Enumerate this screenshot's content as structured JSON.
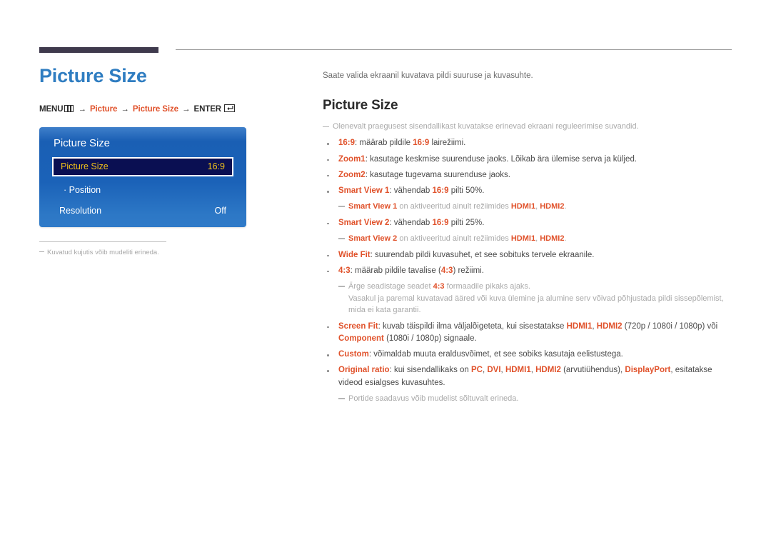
{
  "header": {
    "accent_bar_color": "#3f3a4d",
    "rule_color": "#9b9b9b"
  },
  "left": {
    "page_title": "Picture Size",
    "menu_path": {
      "menu_label": "MENU",
      "menu_icon": "menu-grid-icon",
      "arrow1": "→",
      "item1": "Picture",
      "arrow2": "→",
      "item2": "Picture Size",
      "arrow3": "→",
      "enter_label": "ENTER",
      "enter_icon": "enter-return-icon"
    },
    "osd": {
      "title": "Picture Size",
      "rows": [
        {
          "label": "Picture Size",
          "value": "16:9"
        },
        {
          "label": "· Position",
          "value": ""
        },
        {
          "label": "Resolution",
          "value": "Off"
        }
      ],
      "highlight_text_color": "#f2c21a",
      "highlight_bg_color": "#0a0f52"
    },
    "figure_note": "Kuvatud kujutis võib mudeliti erineda."
  },
  "right": {
    "intro": "Saate valida ekraanil kuvatava pildi suuruse ja kuvasuhte.",
    "section_title": "Picture Size",
    "lead_note": "Olenevalt praegusest sisendallikast kuvatakse erinevad ekraani reguleerimise suvandid.",
    "accent_color": "#e0512a",
    "items": {
      "b1_term": "16:9",
      "b1_mid": ": määrab pildile ",
      "b1_term2": "16:9",
      "b1_tail": " lairežiimi.",
      "b2_term": "Zoom1",
      "b2_text": ": kasutage keskmise suurenduse jaoks. Lõikab ära ülemise serva ja küljed.",
      "b3_term": "Zoom2",
      "b3_text": ": kasutage tugevama suurenduse jaoks.",
      "b4_term": "Smart View 1",
      "b4_mid": ": vähendab ",
      "b4_term2": "16:9",
      "b4_tail": " pilti 50%.",
      "b4_note_term": "Smart View 1",
      "b4_note_mid": " on aktiveeritud ainult režiimides ",
      "b4_note_hdmi1": "HDMI1",
      "b4_note_sep": ", ",
      "b4_note_hdmi2": "HDMI2",
      "b4_note_end": ".",
      "b5_term": "Smart View 2",
      "b5_mid": ": vähendab ",
      "b5_term2": "16:9",
      "b5_tail": " pilti 25%.",
      "b5_note_term": "Smart View 2",
      "b5_note_mid": " on aktiveeritud ainult režiimides ",
      "b5_note_hdmi1": "HDMI1",
      "b5_note_sep": ", ",
      "b5_note_hdmi2": "HDMI2",
      "b5_note_end": ".",
      "b6_term": "Wide Fit",
      "b6_text": ": suurendab pildi kuvasuhet, et see sobituks tervele ekraanile.",
      "b7_term": "4:3",
      "b7_mid": ": määrab pildile tavalise (",
      "b7_term2": "4:3",
      "b7_tail": ") režiimi.",
      "b7_note_pre": "Ärge seadistage seadet ",
      "b7_note_term": "4:3",
      "b7_note_post": " formaadile pikaks ajaks.",
      "b7_note_cont": "Vasakul ja paremal kuvatavad ääred või kuva ülemine ja alumine serv võivad põhjustada pildi sissepõlemist, mida ei kata garantii.",
      "b8_term": "Screen Fit",
      "b8_mid": ": kuvab täispildi ilma väljalõigeteta, kui sisestatakse ",
      "b8_hdmi1": "HDMI1",
      "b8_sep1": ", ",
      "b8_hdmi2": "HDMI2",
      "b8_paren1": " (720p / 1080i / 1080p) või ",
      "b8_component": "Component",
      "b8_tail": " (1080i / 1080p) signaale.",
      "b9_term": "Custom",
      "b9_text": ": võimaldab muuta eraldusvõimet, et see sobiks kasutaja eelistustega.",
      "b10_term": "Original ratio",
      "b10_mid": ": kui sisendallikaks on ",
      "b10_pc": "PC",
      "b10_sep1": ", ",
      "b10_dvi": "DVI",
      "b10_sep2": ", ",
      "b10_hdmi1": "HDMI1",
      "b10_sep3": ", ",
      "b10_hdmi2": "HDMI2",
      "b10_paren": " (arvutiühendus), ",
      "b10_displayport": "DisplayPort",
      "b10_tail": ", esitatakse videod esialgses kuvasuhtes.",
      "b10_note": "Portide saadavus võib mudelist sõltuvalt erineda."
    }
  }
}
